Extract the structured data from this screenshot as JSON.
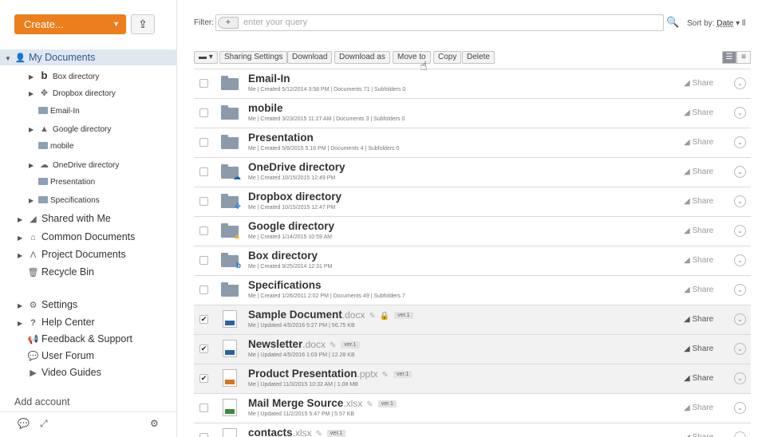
{
  "sidebar": {
    "create_label": "Create...",
    "create_caret": "▼",
    "upload_icon": "upload-icon",
    "tree": [
      {
        "label": "My Documents",
        "icon": "person-icon",
        "arrow": "▼"
      },
      {
        "label": "Box directory",
        "icon": "box-icon",
        "arrow": "▶"
      },
      {
        "label": "Dropbox directory",
        "icon": "dropbox-icon",
        "arrow": "▶"
      },
      {
        "label": "Email-In",
        "icon": "folder-icon",
        "arrow": ""
      },
      {
        "label": "Google directory",
        "icon": "google-drive-icon",
        "arrow": "▶"
      },
      {
        "label": "mobile",
        "icon": "folder-icon",
        "arrow": ""
      },
      {
        "label": "OneDrive directory",
        "icon": "onedrive-icon",
        "arrow": "▶"
      },
      {
        "label": "Presentation",
        "icon": "folder-icon",
        "arrow": ""
      },
      {
        "label": "Specifications",
        "icon": "folder-icon",
        "arrow": "▶"
      },
      {
        "label": "Shared with Me",
        "icon": "share-icon",
        "arrow": "▶"
      },
      {
        "label": "Common Documents",
        "icon": "building-icon",
        "arrow": "▶"
      },
      {
        "label": "Project Documents",
        "icon": "project-icon",
        "arrow": "▶"
      },
      {
        "label": "Recycle Bin",
        "icon": "trash-icon",
        "arrow": ""
      },
      {
        "label": "Settings",
        "icon": "gear-icon",
        "arrow": "▶"
      },
      {
        "label": "Help Center",
        "icon": "question-icon",
        "arrow": "▶"
      },
      {
        "label": "Feedback & Support",
        "icon": "megaphone-icon",
        "arrow": ""
      },
      {
        "label": "User Forum",
        "icon": "chat-icon",
        "arrow": ""
      },
      {
        "label": "Video Guides",
        "icon": "video-icon",
        "arrow": ""
      }
    ],
    "add_account": "Add account"
  },
  "filter": {
    "label": "Filter:",
    "plus": "+",
    "placeholder": "enter your query",
    "sort_label": "Sort by:",
    "sort_value": "Date",
    "sort_caret": "▾"
  },
  "toolbar": {
    "select_toggle": "▬ ▾",
    "buttons": [
      "Sharing Settings",
      "Download",
      "Download as",
      "Move to",
      "Copy",
      "Delete"
    ]
  },
  "files": [
    {
      "title": "Email-In",
      "ext": "",
      "meta": "Me | Created 5/12/2014 3:58 PM | Documents 71 | Subfolders 0",
      "type": "folder",
      "checked": false,
      "share": "Share"
    },
    {
      "title": "mobile",
      "ext": "",
      "meta": "Me | Created 3/23/2015 11:27 AM | Documents 3 | Subfolders 0",
      "type": "folder",
      "checked": false,
      "share": "Share"
    },
    {
      "title": "Presentation",
      "ext": "",
      "meta": "Me | Created 5/8/2015 5:16 PM | Documents 4 | Subfolders 0",
      "type": "folder",
      "checked": false,
      "share": "Share"
    },
    {
      "title": "OneDrive directory",
      "ext": "",
      "meta": "Me | Created 10/15/2015 12:49 PM",
      "type": "folder-onedrive",
      "checked": false,
      "share": "Share"
    },
    {
      "title": "Dropbox directory",
      "ext": "",
      "meta": "Me | Created 10/15/2015 12:47 PM",
      "type": "folder-dropbox",
      "checked": false,
      "share": "Share"
    },
    {
      "title": "Google directory",
      "ext": "",
      "meta": "Me | Created 1/14/2015 10:59 AM",
      "type": "folder-google",
      "checked": false,
      "share": "Share"
    },
    {
      "title": "Box directory",
      "ext": "",
      "meta": "Me | Created 9/25/2014 12:31 PM",
      "type": "folder-box",
      "checked": false,
      "share": "Share"
    },
    {
      "title": "Specifications",
      "ext": "",
      "meta": "Me | Created 1/26/2011 2:02 PM | Documents 49 | Subfolders 7",
      "type": "folder",
      "checked": false,
      "share": "Share"
    },
    {
      "title": "Sample Document",
      "ext": ".docx",
      "meta": "Me | Updated 4/5/2016 5:27 PM | 56.75 KB",
      "type": "doc",
      "checked": true,
      "share": "Share",
      "ver": "ver.1",
      "locked": true
    },
    {
      "title": "Newsletter",
      "ext": ".docx",
      "meta": "Me | Updated 4/5/2016 1:03 PM | 12.28 KB",
      "type": "doc",
      "checked": true,
      "share": "Share",
      "ver": "ver.1",
      "locked": false
    },
    {
      "title": "Product Presentation",
      "ext": ".pptx",
      "meta": "Me | Updated 11/3/2015 10:32 AM | 1.08 MB",
      "type": "ppt",
      "checked": true,
      "share": "Share",
      "ver": "ver.1",
      "locked": false
    },
    {
      "title": "Mail Merge Source",
      "ext": ".xlsx",
      "meta": "Me | Updated 11/2/2015 5:47 PM | 5.57 KB",
      "type": "xls",
      "checked": false,
      "share": "Share",
      "ver": "ver.1",
      "locked": false
    },
    {
      "title": "contacts",
      "ext": ".xlsx",
      "meta": "",
      "type": "xls",
      "checked": false,
      "share": "Share",
      "ver": "ver.1",
      "locked": false
    }
  ],
  "colors": {
    "accent": "#ec7e1c",
    "active_bg": "#dfe8f1",
    "selected_row": "#f2f2f2"
  }
}
